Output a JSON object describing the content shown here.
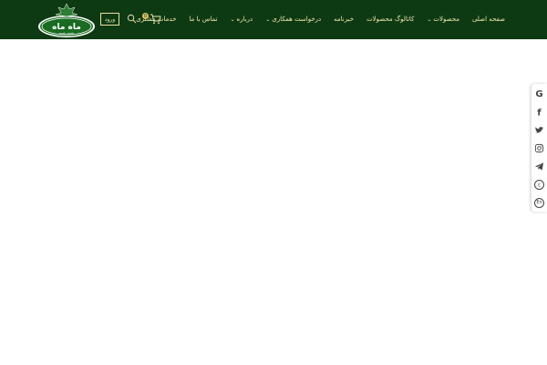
{
  "header": {
    "logo_text": "ماه ماه",
    "logo_sub": "mah-mah",
    "nav": [
      {
        "label": "صفحه اصلی",
        "has_dropdown": false
      },
      {
        "label": "محصولات",
        "has_dropdown": true
      },
      {
        "label": "کاتالوگ محصولات",
        "has_dropdown": false
      },
      {
        "label": "خبرنامه",
        "has_dropdown": false
      },
      {
        "label": "درخواست همکاری",
        "has_dropdown": true
      },
      {
        "label": "درباره",
        "has_dropdown": true
      },
      {
        "label": "تماس با ما",
        "has_dropdown": false
      },
      {
        "label": "خدمات مشتری",
        "has_dropdown": false
      }
    ],
    "login_label": "ورود",
    "cart_count": "0",
    "icons": {
      "search": "search-icon",
      "cart": "cart-icon"
    },
    "colors": {
      "header_bg": "#0e3a13",
      "nav_text": "#f0e8b0",
      "badge": "#e0c060"
    }
  },
  "social": {
    "items": [
      {
        "name": "google-icon"
      },
      {
        "name": "facebook-icon"
      },
      {
        "name": "twitter-icon"
      },
      {
        "name": "instagram-icon"
      },
      {
        "name": "telegram-icon"
      },
      {
        "name": "language-ar-icon",
        "label": "ع"
      },
      {
        "name": "language-en-icon",
        "label": "En"
      }
    ]
  }
}
